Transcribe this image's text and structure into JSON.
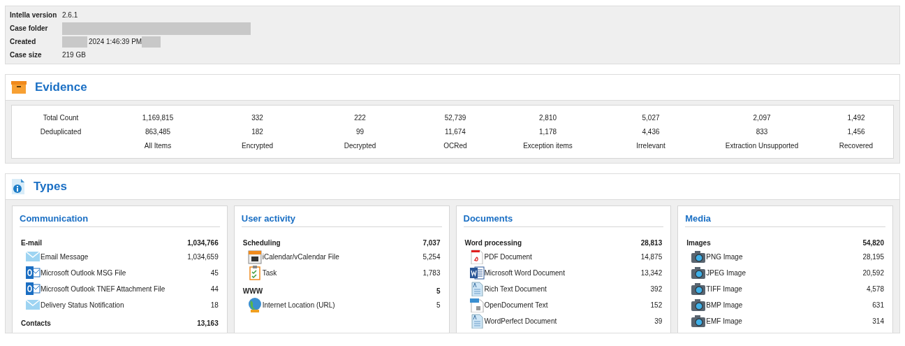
{
  "case_info": [
    {
      "label": "Intella version",
      "value": "2.6.1",
      "redacted": false
    },
    {
      "label": "Case folder",
      "redacted": true
    },
    {
      "label": "Created",
      "value": "2024 1:46:39 PM",
      "redacted": true
    },
    {
      "label": "Case size",
      "value": "219 GB",
      "redacted": false
    }
  ],
  "evidence": {
    "title": "Evidence",
    "row_labels": [
      "Total Count",
      "Deduplicated"
    ],
    "columns": [
      {
        "total": "1,169,815",
        "deduplicated": "863,485",
        "label": "All Items"
      },
      {
        "total": "332",
        "deduplicated": "182",
        "label": "Encrypted"
      },
      {
        "total": "222",
        "deduplicated": "99",
        "label": "Decrypted"
      },
      {
        "total": "52,739",
        "deduplicated": "11,674",
        "label": "OCRed"
      },
      {
        "total": "2,810",
        "deduplicated": "1,178",
        "label": "Exception items"
      },
      {
        "total": "5,027",
        "deduplicated": "4,436",
        "label": "Irrelevant"
      },
      {
        "total": "2,097",
        "deduplicated": "833",
        "label": "Extraction Unsupported"
      },
      {
        "total": "1,492",
        "deduplicated": "1,456",
        "label": "Recovered"
      }
    ]
  },
  "types": {
    "title": "Types",
    "cards": [
      {
        "title": "Communication",
        "groups": [
          {
            "name": "E-mail",
            "count": "1,034,766",
            "items": [
              {
                "kind": "email",
                "name": "Email Message",
                "count": "1,034,659"
              },
              {
                "kind": "outlook",
                "name": "Microsoft Outlook MSG File",
                "count": "45"
              },
              {
                "kind": "outlook",
                "name": "Microsoft Outlook TNEF Attachment File",
                "count": "44"
              },
              {
                "kind": "email",
                "name": "Delivery Status Notification",
                "count": "18"
              }
            ]
          },
          {
            "name": "Contacts",
            "count": "13,163"
          }
        ]
      },
      {
        "title": "User activity",
        "groups": [
          {
            "name": "Scheduling",
            "count": "7,037",
            "items": [
              {
                "kind": "calendar",
                "name": "iCalendar/vCalendar File",
                "count": "5,254"
              },
              {
                "kind": "task",
                "name": "Task",
                "count": "1,783"
              }
            ]
          },
          {
            "name": "WWW",
            "count": "5",
            "items": [
              {
                "kind": "globe",
                "name": "Internet Location (URL)",
                "count": "5"
              }
            ]
          }
        ]
      },
      {
        "title": "Documents",
        "groups": [
          {
            "name": "Word processing",
            "count": "28,813",
            "items": [
              {
                "kind": "pdf",
                "name": "PDF Document",
                "count": "14,875"
              },
              {
                "kind": "word",
                "name": "Microsoft Word Document",
                "count": "13,342"
              },
              {
                "kind": "text",
                "name": "Rich Text Document",
                "count": "392"
              },
              {
                "kind": "odt",
                "name": "OpenDocument Text",
                "count": "152"
              },
              {
                "kind": "text",
                "name": "WordPerfect Document",
                "count": "39"
              }
            ]
          }
        ]
      },
      {
        "title": "Media",
        "groups": [
          {
            "name": "Images",
            "count": "54,820",
            "items": [
              {
                "kind": "camera",
                "name": "PNG Image",
                "count": "28,195"
              },
              {
                "kind": "camera",
                "name": "JPEG Image",
                "count": "20,592"
              },
              {
                "kind": "camera",
                "name": "TIFF Image",
                "count": "4,578"
              },
              {
                "kind": "camera",
                "name": "BMP Image",
                "count": "631"
              },
              {
                "kind": "camera",
                "name": "EMF Image",
                "count": "314"
              }
            ]
          }
        ]
      }
    ]
  }
}
